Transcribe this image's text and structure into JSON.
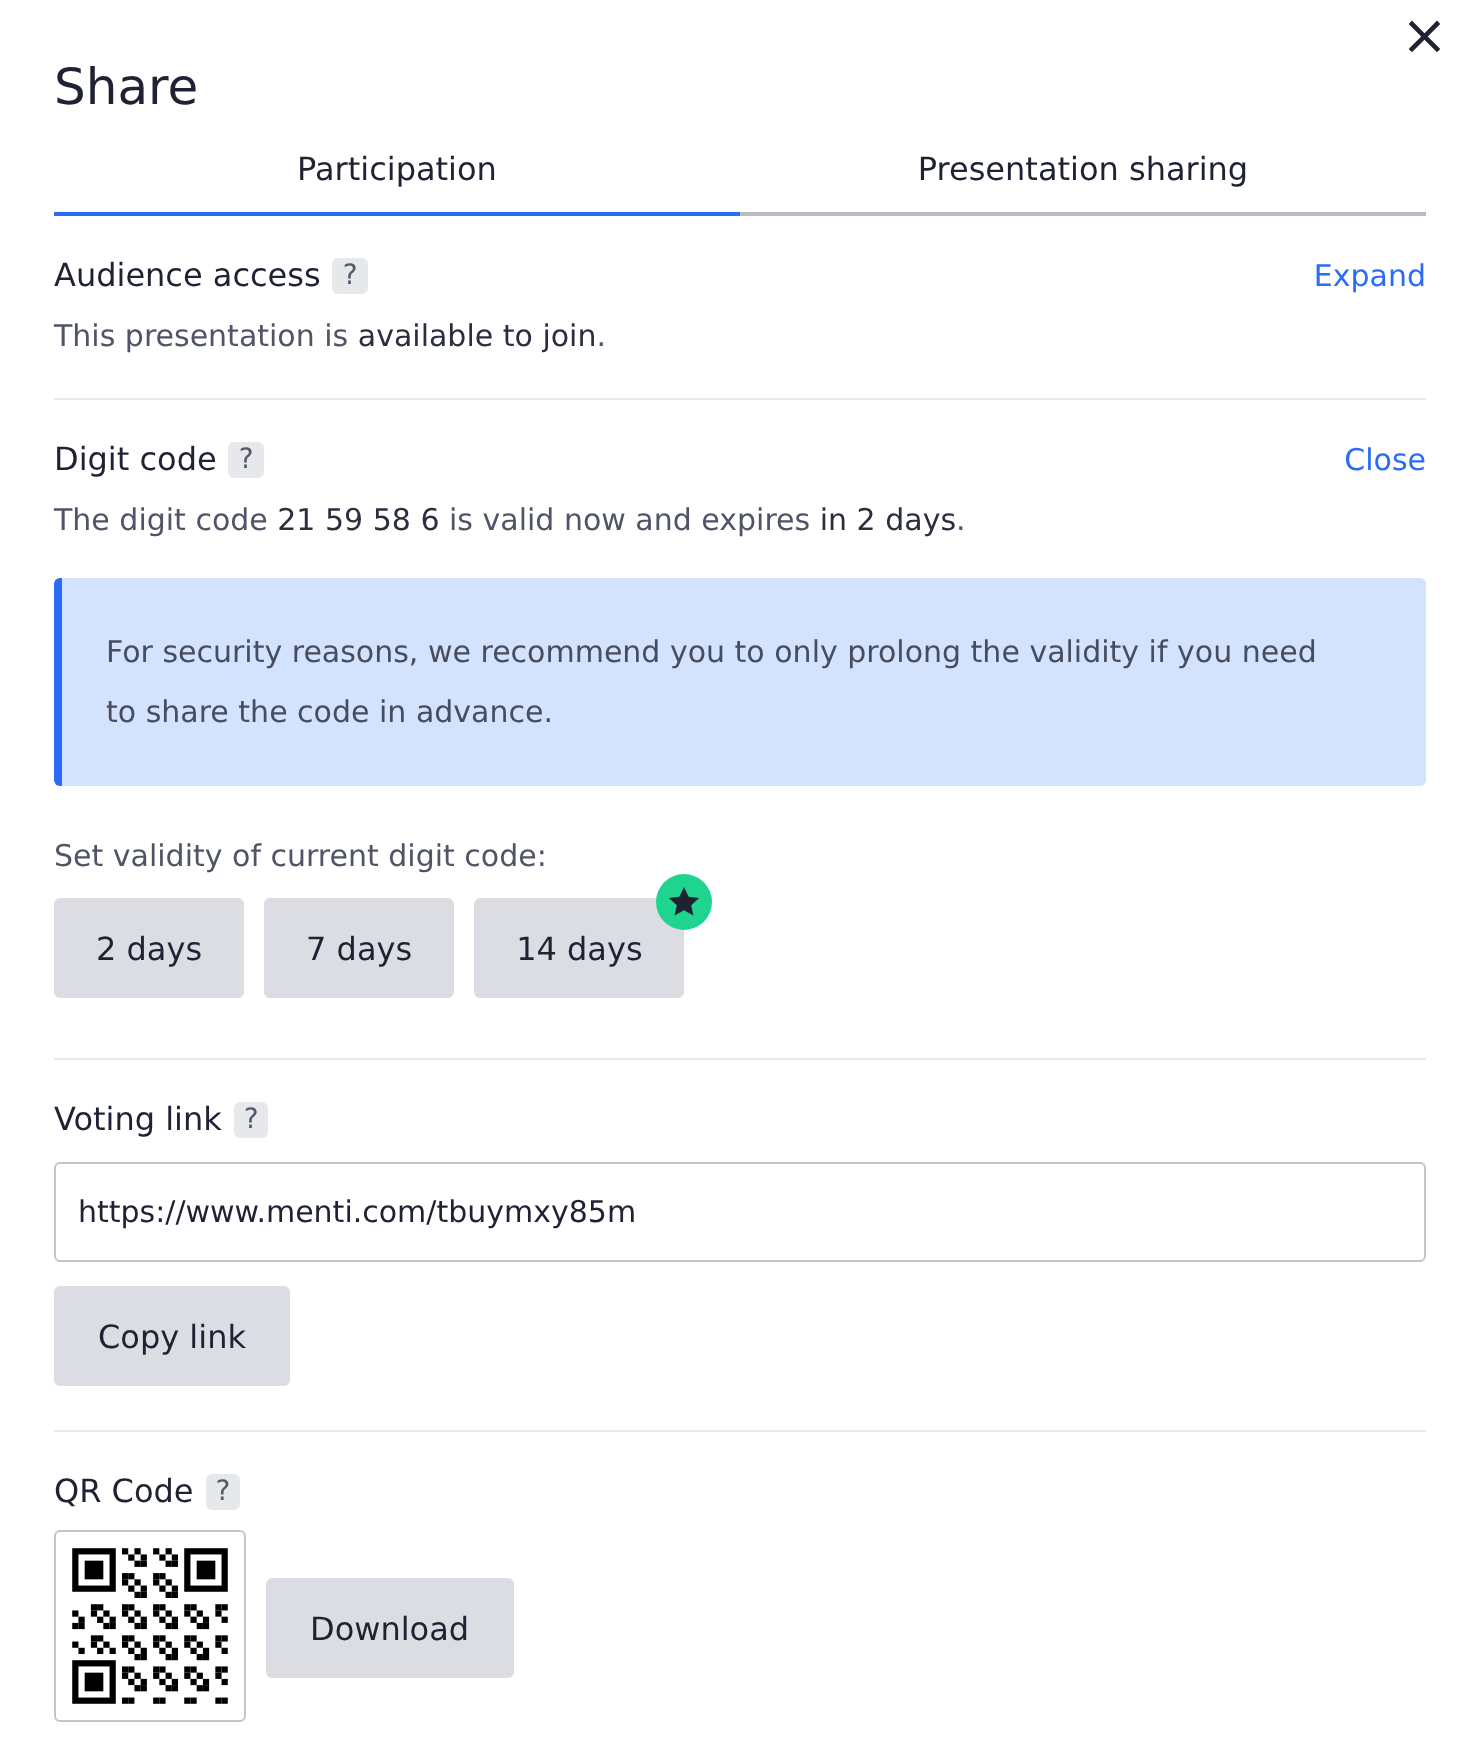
{
  "dialog": {
    "title": "Share",
    "close_icon": "×"
  },
  "tabs": [
    {
      "label": "Participation",
      "selected": true
    },
    {
      "label": "Presentation sharing",
      "selected": false
    }
  ],
  "audience_access": {
    "heading": "Audience access",
    "help": "?",
    "action": "Expand",
    "description": "This presentation is **available to join**."
  },
  "digit_code": {
    "heading": "Digit code",
    "help": "?",
    "action": "Close",
    "description": "The digit code **21 59 58 6** is valid now and expires **in 2 days**.",
    "notice": "For security reasons, we recommend you to only prolong the validity if you need to share the code in advance.",
    "validity_label": "Set validity of current digit code:",
    "validity_options": [
      {
        "label": "2 days",
        "premium": false
      },
      {
        "label": "7 days",
        "premium": false
      },
      {
        "label": "14 days",
        "premium": true
      }
    ]
  },
  "voting_link": {
    "heading": "Voting link",
    "help": "?",
    "value": "https://www.menti.com/tbuymxy85m",
    "button": "Copy link"
  },
  "qr_code": {
    "heading": "QR Code",
    "help": "?",
    "button": "Download"
  }
}
